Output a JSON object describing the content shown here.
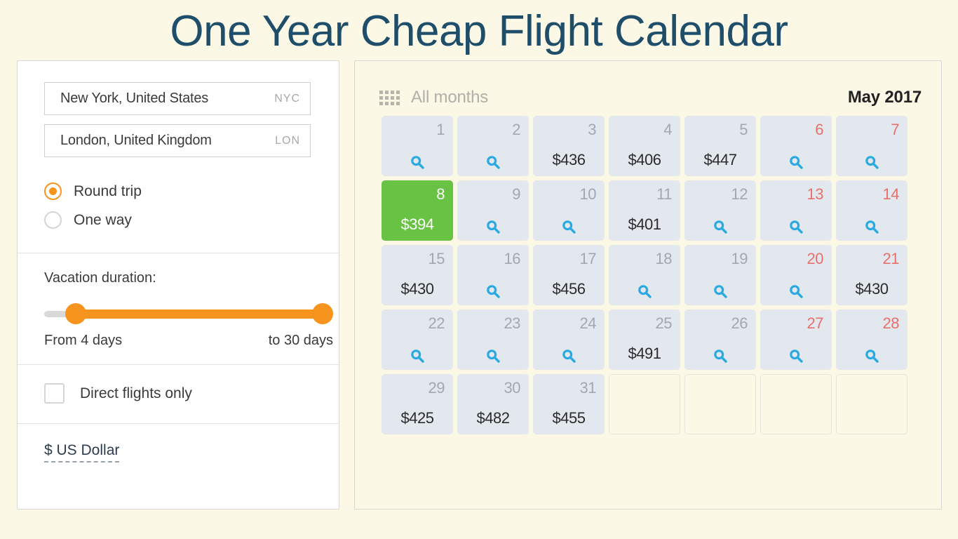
{
  "page": {
    "title": "One Year Cheap Flight Calendar",
    "background_color": "#fbf8e6",
    "title_color": "#1f4e6b"
  },
  "search_panel": {
    "origin": {
      "city": "New York, United States",
      "code": "NYC"
    },
    "destination": {
      "city": "London, United Kingdom",
      "code": "LON"
    },
    "trip_type": {
      "options": [
        {
          "label": "Round trip",
          "selected": true
        },
        {
          "label": "One way",
          "selected": false
        }
      ]
    },
    "duration": {
      "title": "Vacation duration:",
      "from_label": "From 4 days",
      "to_label": "to 30 days",
      "min_days": 4,
      "max_days": 30,
      "accent_color": "#f7941e"
    },
    "direct_flights": {
      "label": "Direct flights only",
      "checked": false
    },
    "currency": {
      "label": "$ US Dollar"
    }
  },
  "calendar": {
    "months_toggle_label": "All months",
    "months_icon": "grid-dots-icon",
    "current_month": "May 2017",
    "selected_day": 8,
    "search_icon": "magnifier-icon",
    "cell_color": "#e3e8ee",
    "selected_color": "#68c244",
    "weekend_color": "#e8706c",
    "search_icon_color": "#29abe2",
    "days": [
      {
        "day": 1,
        "price": null,
        "weekend": false,
        "selected": false
      },
      {
        "day": 2,
        "price": null,
        "weekend": false,
        "selected": false
      },
      {
        "day": 3,
        "price": "$436",
        "weekend": false,
        "selected": false
      },
      {
        "day": 4,
        "price": "$406",
        "weekend": false,
        "selected": false
      },
      {
        "day": 5,
        "price": "$447",
        "weekend": false,
        "selected": false
      },
      {
        "day": 6,
        "price": null,
        "weekend": true,
        "selected": false
      },
      {
        "day": 7,
        "price": null,
        "weekend": true,
        "selected": false
      },
      {
        "day": 8,
        "price": "$394",
        "weekend": false,
        "selected": true
      },
      {
        "day": 9,
        "price": null,
        "weekend": false,
        "selected": false
      },
      {
        "day": 10,
        "price": null,
        "weekend": false,
        "selected": false
      },
      {
        "day": 11,
        "price": "$401",
        "weekend": false,
        "selected": false
      },
      {
        "day": 12,
        "price": null,
        "weekend": false,
        "selected": false
      },
      {
        "day": 13,
        "price": null,
        "weekend": true,
        "selected": false
      },
      {
        "day": 14,
        "price": null,
        "weekend": true,
        "selected": false
      },
      {
        "day": 15,
        "price": "$430",
        "weekend": false,
        "selected": false
      },
      {
        "day": 16,
        "price": null,
        "weekend": false,
        "selected": false
      },
      {
        "day": 17,
        "price": "$456",
        "weekend": false,
        "selected": false
      },
      {
        "day": 18,
        "price": null,
        "weekend": false,
        "selected": false
      },
      {
        "day": 19,
        "price": null,
        "weekend": false,
        "selected": false
      },
      {
        "day": 20,
        "price": null,
        "weekend": true,
        "selected": false
      },
      {
        "day": 21,
        "price": "$430",
        "weekend": true,
        "selected": false
      },
      {
        "day": 22,
        "price": null,
        "weekend": false,
        "selected": false
      },
      {
        "day": 23,
        "price": null,
        "weekend": false,
        "selected": false
      },
      {
        "day": 24,
        "price": null,
        "weekend": false,
        "selected": false
      },
      {
        "day": 25,
        "price": "$491",
        "weekend": false,
        "selected": false
      },
      {
        "day": 26,
        "price": null,
        "weekend": false,
        "selected": false
      },
      {
        "day": 27,
        "price": null,
        "weekend": true,
        "selected": false
      },
      {
        "day": 28,
        "price": null,
        "weekend": true,
        "selected": false
      },
      {
        "day": 29,
        "price": "$425",
        "weekend": false,
        "selected": false
      },
      {
        "day": 30,
        "price": "$482",
        "weekend": false,
        "selected": false
      },
      {
        "day": 31,
        "price": "$455",
        "weekend": false,
        "selected": false
      },
      {
        "day": null,
        "price": null,
        "weekend": false,
        "selected": false
      },
      {
        "day": null,
        "price": null,
        "weekend": false,
        "selected": false
      },
      {
        "day": null,
        "price": null,
        "weekend": false,
        "selected": false
      },
      {
        "day": null,
        "price": null,
        "weekend": false,
        "selected": false
      }
    ]
  }
}
